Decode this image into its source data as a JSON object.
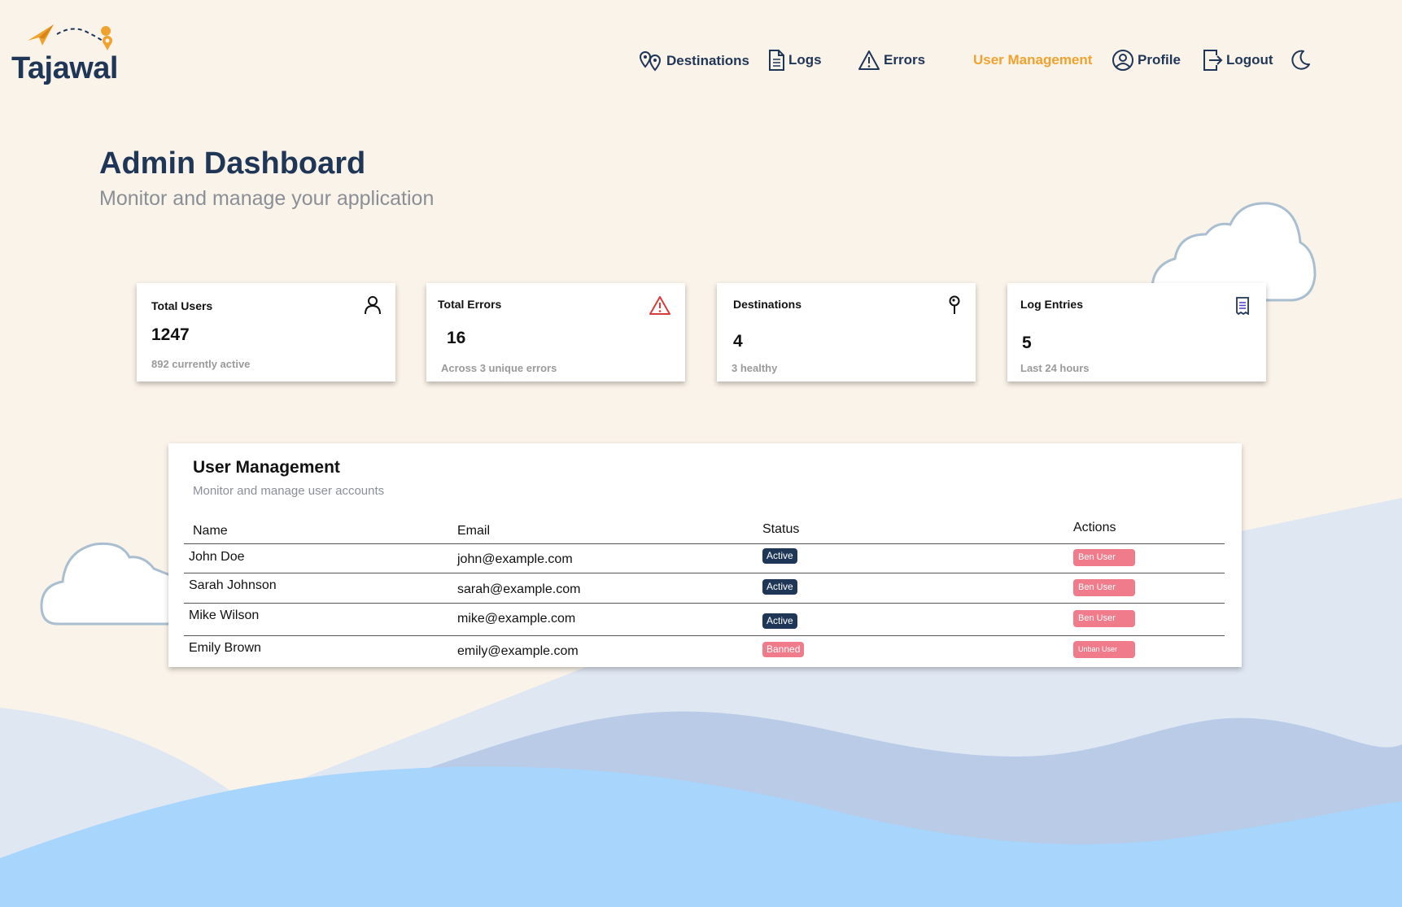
{
  "brand": {
    "name": "Tajawal"
  },
  "nav": {
    "items": [
      {
        "label": "Destinations",
        "icon": "map-pins-icon"
      },
      {
        "label": "Logs",
        "icon": "document-icon"
      },
      {
        "label": "Errors",
        "icon": "warning-icon"
      },
      {
        "label": "User Management",
        "icon": "",
        "active": true
      },
      {
        "label": "Profile",
        "icon": "user-circle-icon"
      },
      {
        "label": "Logout",
        "icon": "logout-icon"
      }
    ],
    "theme_toggle_icon": "moon-icon"
  },
  "page": {
    "title": "Admin Dashboard",
    "subtitle": "Monitor and manage your application"
  },
  "stats": [
    {
      "title": "Total Users",
      "value": "1247",
      "note": "892 currently active",
      "icon": "user-icon"
    },
    {
      "title": "Total Errors",
      "value": "16",
      "note": "Across 3 unique errors",
      "icon": "warning-icon"
    },
    {
      "title": "Destinations",
      "value": "4",
      "note": "3 healthy",
      "icon": "pin-icon"
    },
    {
      "title": "Log Entries",
      "value": "5",
      "note": "Last 24 hours",
      "icon": "receipt-icon"
    }
  ],
  "users_panel": {
    "title": "User Management",
    "subtitle": "Monitor and manage user accounts",
    "columns": [
      "Name",
      "Email",
      "Status",
      "Actions"
    ],
    "rows": [
      {
        "name": "John Doe",
        "email": "john@example.com",
        "status": "Active",
        "action": "Ben User"
      },
      {
        "name": "Sarah Johnson",
        "email": "sarah@example.com",
        "status": "Active",
        "action": "Ben User"
      },
      {
        "name": "Mike Wilson",
        "email": "mike@example.com",
        "status": "Active",
        "action": "Ben User"
      },
      {
        "name": "Emily Brown",
        "email": "emily@example.com",
        "status": "Banned",
        "action": "Unban User"
      }
    ]
  },
  "colors": {
    "background": "#faf3e9",
    "navy": "#1f3657",
    "accent": "#f0a22e",
    "danger": "#f07b8a",
    "wave_light": "#dfe7f3",
    "wave_mid": "#b9cbe6",
    "wave_bright": "#a7d5fb"
  }
}
